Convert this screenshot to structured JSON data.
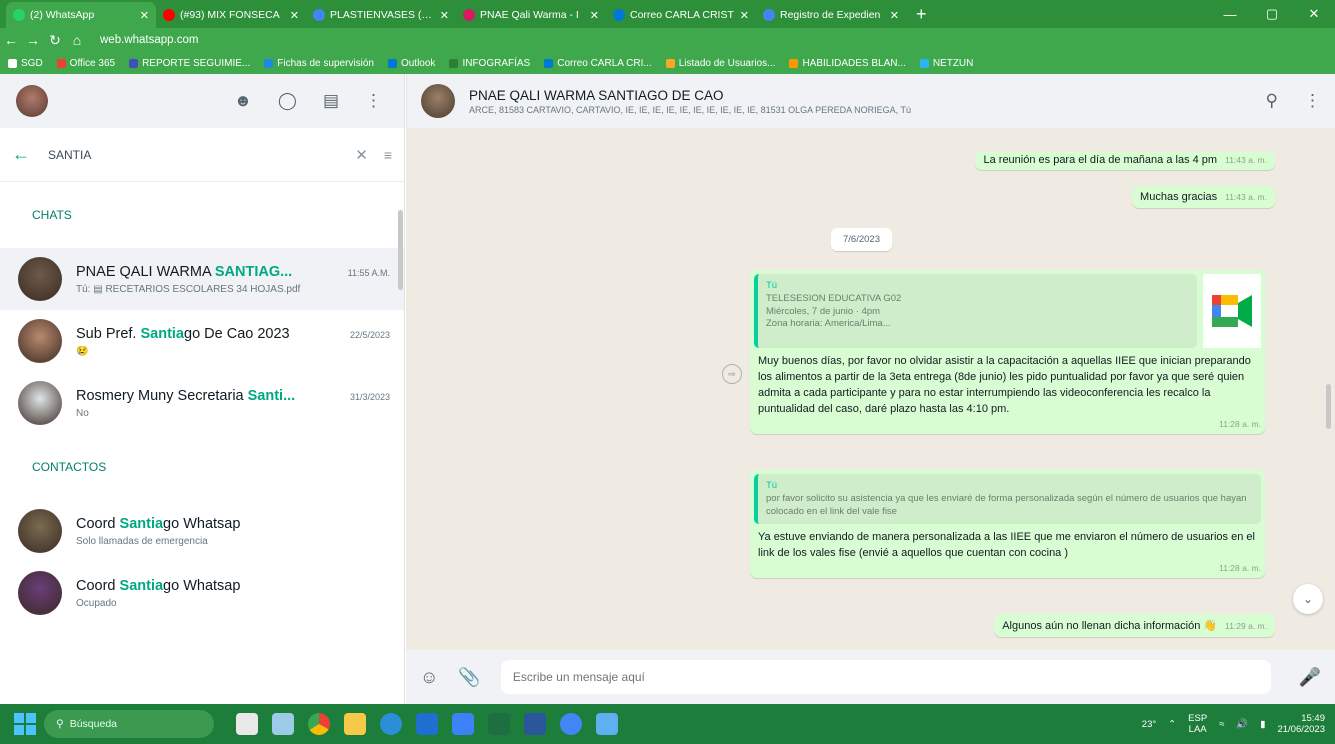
{
  "browser": {
    "tabs": [
      {
        "title": "(2) WhatsApp",
        "color": "#25d366"
      },
      {
        "title": "(#93) MIX FONSECA",
        "color": "#ff0000"
      },
      {
        "title": "PLASTIENVASES (TLp",
        "color": "#4285f4"
      },
      {
        "title": "PNAE Qali Warma - I",
        "color": "#d81b60"
      },
      {
        "title": "Correo CARLA CRIST",
        "color": "#0078d4"
      },
      {
        "title": "Registro de Expedien",
        "color": "#4285f4"
      }
    ],
    "new_tab": "+",
    "url": "web.whatsapp.com",
    "bookmarks": [
      {
        "label": "SGD",
        "color": "#ffffff"
      },
      {
        "label": "Office 365",
        "color": "#ea4335"
      },
      {
        "label": "REPORTE SEGUIMIE...",
        "color": "#3f51b5"
      },
      {
        "label": "Fichas de supervisión",
        "color": "#1e88e5"
      },
      {
        "label": "Outlook",
        "color": "#0078d4"
      },
      {
        "label": "INFOGRAFÍAS",
        "color": "#2e7d32"
      },
      {
        "label": "Correo CARLA CRI...",
        "color": "#0078d4"
      },
      {
        "label": "Listado de Usuarios...",
        "color": "#f9a825"
      },
      {
        "label": "HABILIDADES BLAN...",
        "color": "#ff9800"
      },
      {
        "label": "NETZUN",
        "color": "#29b6f6"
      }
    ]
  },
  "sidebar": {
    "search_query": "SANTIA",
    "chats_heading": "CHATS",
    "contacts_heading": "CONTACTOS",
    "chats": [
      {
        "pre": "PNAE QALI WARMA ",
        "match": "SANTIAG...",
        "post": "",
        "time": "11:55 A.M.",
        "sub": "Tú: ▤ RECETARIOS ESCOLARES 34 HOJAS.pdf",
        "avatar": "#6d5a4a"
      },
      {
        "pre": "Sub Pref. ",
        "match": "Santia",
        "post": "go De Cao 2023",
        "time": "22/5/2023",
        "sub": "😢",
        "avatar": "#b98a6e"
      },
      {
        "pre": "Rosmery Muny Secretaria ",
        "match": "Santi...",
        "post": "",
        "time": "31/3/2023",
        "sub": "No",
        "avatar": "#dfe5e7"
      }
    ],
    "contacts": [
      {
        "pre": "Coord ",
        "match": "Santia",
        "post": "go Whatsap",
        "sub": "Solo llamadas de emergencia",
        "avatar": "#7a6b52"
      },
      {
        "pre": "Coord ",
        "match": "Santia",
        "post": "go Whatsap",
        "sub": "Ocupado",
        "avatar": "#6a3d7a"
      }
    ]
  },
  "conversation": {
    "title": "PNAE QALI WARMA SANTIAGO DE CAO",
    "members": "ARCE, 81583 CARTAVIO, CARTAVIO, IE, IE, IE, IE, IE, IE, IE, IE, IE, IE, 81531 OLGA PEREDA NORIEGA, Tú",
    "messages": {
      "m1_text": "La reunión es para el día de mañana a las 4 pm",
      "m1_time": "11:43 a. m.",
      "m2_text": "Muchas gracias",
      "m2_time": "11:43 a. m.",
      "date_chip": "7/6/2023",
      "q1_who": "Tú",
      "q1_line1": "TELESESION EDUCATIVA G02",
      "q1_line2": "Miércoles, 7 de junio · 4pm",
      "q1_line3": "Zona horaria: America/Lima...",
      "m3_text": "Muy buenos días, por favor no olvidar asistir a la capacitación a aquellas IIEE que inician preparando los alimentos a partir de la 3eta entrega (8de junio) les pido puntualidad por favor ya que seré quien admita a cada participante y para no estar interrumpiendo las videoconferencia les recalco la puntualidad del caso, daré plazo hasta las 4:10 pm.",
      "m3_time": "11:28 a. m.",
      "q2_who": "Tú",
      "q2_text": "por favor solicito su asistencia ya que les enviaré de forma personalizada según el número de usuarios que hayan colocado en el link del vale fise",
      "m4_text": "Ya estuve enviando de manera personalizada a las IIEE que me enviaron el número de usuarios en el link de los vales fise (envié a aquellos que cuentan con cocina )",
      "m4_time": "11:28 a. m.",
      "m5_text": "Algunos aún no llenan dicha información 👋",
      "m5_time": "11:29 a. m."
    },
    "compose_placeholder": "Escribe un mensaje aquí"
  },
  "taskbar": {
    "search_label": "Búsqueda",
    "temperature": "23°",
    "lang_top": "ESP",
    "lang_bottom": "LAA",
    "time": "15:49",
    "date": "21/06/2023"
  }
}
